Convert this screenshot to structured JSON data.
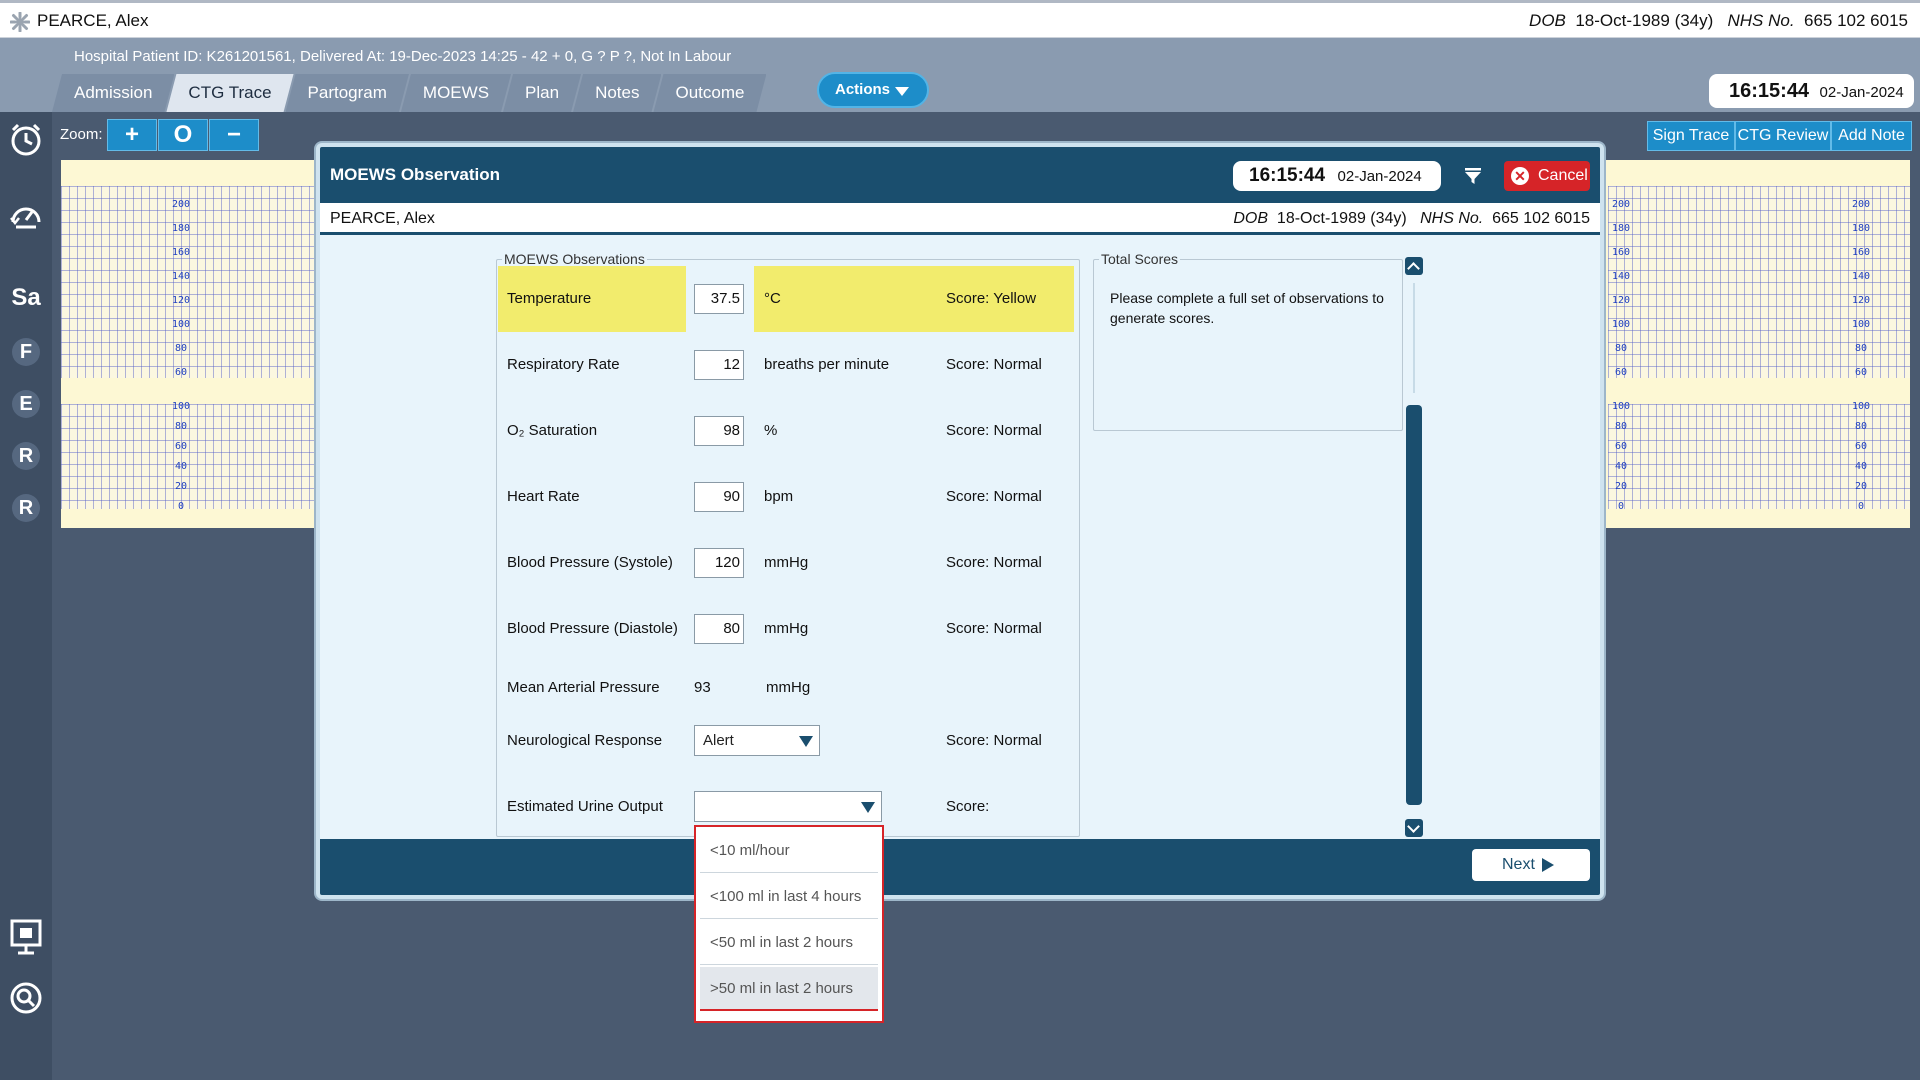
{
  "patient": {
    "name": "PEARCE, Alex",
    "dob_label": "DOB",
    "dob": "18-Oct-1989 (34y)",
    "nhs_label": "NHS No.",
    "nhs": "665 102 6015"
  },
  "header": {
    "hospital_line": "Hospital Patient ID: K261201561, Delivered At: 19-Dec-2023 14:25 - 42 + 0, G ? P ?,   Not In Labour",
    "tabs": [
      "Admission",
      "CTG Trace",
      "Partogram",
      "MOEWS",
      "Plan",
      "Notes",
      "Outcome"
    ],
    "active_tab": "CTG Trace",
    "actions_label": "Actions",
    "time": "16:15:44",
    "date": "02-Jan-2024"
  },
  "sidebar": {
    "icons": [
      "alarm-clock-icon",
      "gauge-history-icon",
      "presentation-icon",
      "search-icon"
    ],
    "letters": [
      "Sa",
      "F",
      "E",
      "R",
      "R"
    ]
  },
  "toolbar": {
    "zoom_label": "Zoom:",
    "zoom_in": "+",
    "zoom_reset": "O",
    "zoom_out": "−",
    "sign_trace": "Sign Trace",
    "ctg_review": "CTG Review",
    "add_note": "Add Note"
  },
  "trace_scale": {
    "upper": [
      "200",
      "180",
      "160",
      "140",
      "120",
      "100",
      "80",
      "60"
    ],
    "lower": [
      "100",
      "80",
      "60",
      "40",
      "20",
      "0"
    ]
  },
  "modal": {
    "title": "MOEWS Observation",
    "time": "16:15:44",
    "date": "02-Jan-2024",
    "cancel_label": "Cancel",
    "obs_legend": "MOEWS Observations",
    "totals_legend": "Total Scores",
    "totals_text": "Please complete a full set of observations to generate scores.",
    "next_label": "Next",
    "observations": [
      {
        "label": "Temperature",
        "value": "37.5",
        "unit": "°C",
        "score": "Score: Yellow",
        "highlight": "#f2ec6d"
      },
      {
        "label": "Respiratory Rate",
        "value": "12",
        "unit": "breaths per minute",
        "score": "Score: Normal"
      },
      {
        "label": "O₂ Saturation",
        "value": "98",
        "unit": "%",
        "score": "Score: Normal"
      },
      {
        "label": "Heart Rate",
        "value": "90",
        "unit": "bpm",
        "score": "Score: Normal"
      },
      {
        "label": "Blood Pressure (Systole)",
        "value": "120",
        "unit": "mmHg",
        "score": "Score: Normal"
      },
      {
        "label": "Blood Pressure (Diastole)",
        "value": "80",
        "unit": "mmHg",
        "score": "Score: Normal"
      }
    ],
    "map": {
      "label": "Mean Arterial Pressure",
      "value": "93",
      "unit": "mmHg"
    },
    "neuro": {
      "label": "Neurological Response",
      "value": "Alert",
      "score": "Score: Normal"
    },
    "urine": {
      "label": "Estimated Urine Output",
      "value": "",
      "score": "Score:"
    },
    "urine_options": [
      "<10 ml/hour",
      "<100 ml in last 4 hours",
      "<50 ml in last 2 hours",
      ">50 ml in last 2 hours"
    ],
    "urine_hovered": ">50 ml in last 2 hours"
  },
  "colors": {
    "accent": "#1d8dc9",
    "modal_header": "#1a4e6e",
    "highlight_yellow": "#f2ec6d",
    "cancel_red": "#d62428"
  }
}
